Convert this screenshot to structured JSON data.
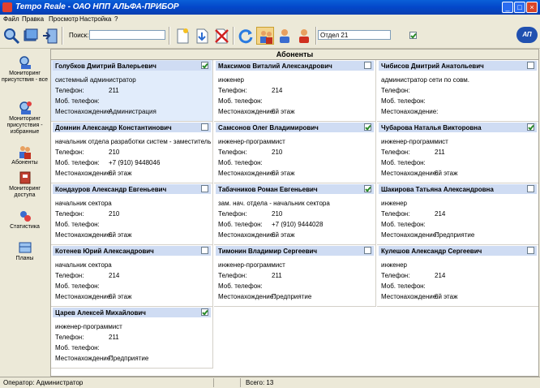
{
  "window": {
    "title": "Tempo Reale - ОАО НПП АЛЬФА-ПРИБОР"
  },
  "menu": [
    "Файл",
    "Правка",
    "Просмотр",
    "Настройка",
    "?"
  ],
  "toolbar": {
    "search_label": "Поиск:",
    "search_value": "",
    "department_value": "Отдел 21",
    "department_button": "...",
    "department_checked": true,
    "logo_text": "АП"
  },
  "sidebar": [
    {
      "label": "Мониторинг присутствия - все",
      "icon": "monitor-all-icon"
    },
    {
      "label": "Мониторинг присутствия - избранные",
      "icon": "monitor-favorites-icon"
    },
    {
      "label": "Абоненты",
      "icon": "subscribers-icon"
    },
    {
      "label": "Мониторинг доступа",
      "icon": "access-monitor-icon"
    },
    {
      "label": "Статистика",
      "icon": "statistics-icon"
    },
    {
      "label": "Планы",
      "icon": "plans-icon"
    }
  ],
  "main": {
    "title": "Абоненты"
  },
  "field_labels": {
    "phone": "Телефон:",
    "mobile": "Моб. телефон:",
    "location": "Местонахождение:"
  },
  "cards": [
    {
      "name": "Голубков Дмитрий Валерьевич",
      "checked": true,
      "selected": true,
      "position": "системный администратор",
      "phone": "211",
      "mobile": "",
      "location": "Администрация"
    },
    {
      "name": "Максимов Виталий Александрович",
      "checked": false,
      "selected": false,
      "position": "инженер",
      "phone": "214",
      "mobile": "",
      "location": "6й этаж"
    },
    {
      "name": "Чибисов Дмитрий Анатольевич",
      "checked": false,
      "selected": false,
      "position": "администратор сети по совм.",
      "phone": "",
      "mobile": "",
      "location": ""
    },
    {
      "name": "Домнин Александр Константинович",
      "checked": false,
      "selected": false,
      "position": "начальник отдела разработки систем - заместитель гла",
      "phone": "210",
      "mobile": "+7 (910) 9448046",
      "location": "6й этаж"
    },
    {
      "name": "Самсонов Олег Владимирович",
      "checked": true,
      "selected": false,
      "position": "инженер-программист",
      "phone": "210",
      "mobile": "",
      "location": "6й этаж"
    },
    {
      "name": "Чубарова Наталья Викторовна",
      "checked": true,
      "selected": false,
      "position": "инженер-программист",
      "phone": "211",
      "mobile": "",
      "location": "6й этаж"
    },
    {
      "name": "Кондауров Александр Евгеньевич",
      "checked": false,
      "selected": false,
      "position": "начальник сектора",
      "phone": "210",
      "mobile": "",
      "location": "6й этаж"
    },
    {
      "name": "Табачников Роман Евгеньевич",
      "checked": true,
      "selected": false,
      "position": "зам. нач. отдела - начальник сектора",
      "phone": "210",
      "mobile": "+7 (910) 9444028",
      "location": "6й этаж"
    },
    {
      "name": "Шакирова Татьяна Александровна",
      "checked": false,
      "selected": false,
      "position": "инженер",
      "phone": "214",
      "mobile": "",
      "location": "Предприятие"
    },
    {
      "name": "Котенев Юрий Александрович",
      "checked": false,
      "selected": false,
      "position": "начальник сектора",
      "phone": "214",
      "mobile": "",
      "location": "6й этаж"
    },
    {
      "name": "Тимонин Владимир Сергеевич",
      "checked": false,
      "selected": false,
      "position": "инженер-программист",
      "phone": "211",
      "mobile": "",
      "location": "Предприятие"
    },
    {
      "name": "Кулешов Александр Сергеевич",
      "checked": false,
      "selected": false,
      "position": "инженер",
      "phone": "214",
      "mobile": "",
      "location": "6й этаж"
    },
    {
      "name": "Царев Алексей Михайлович",
      "checked": true,
      "selected": false,
      "position": "инженер-программист",
      "phone": "211",
      "mobile": "",
      "location": "Предприятие"
    }
  ],
  "status": {
    "operator": "Оператор: Администратор",
    "total": "Всего: 13"
  }
}
